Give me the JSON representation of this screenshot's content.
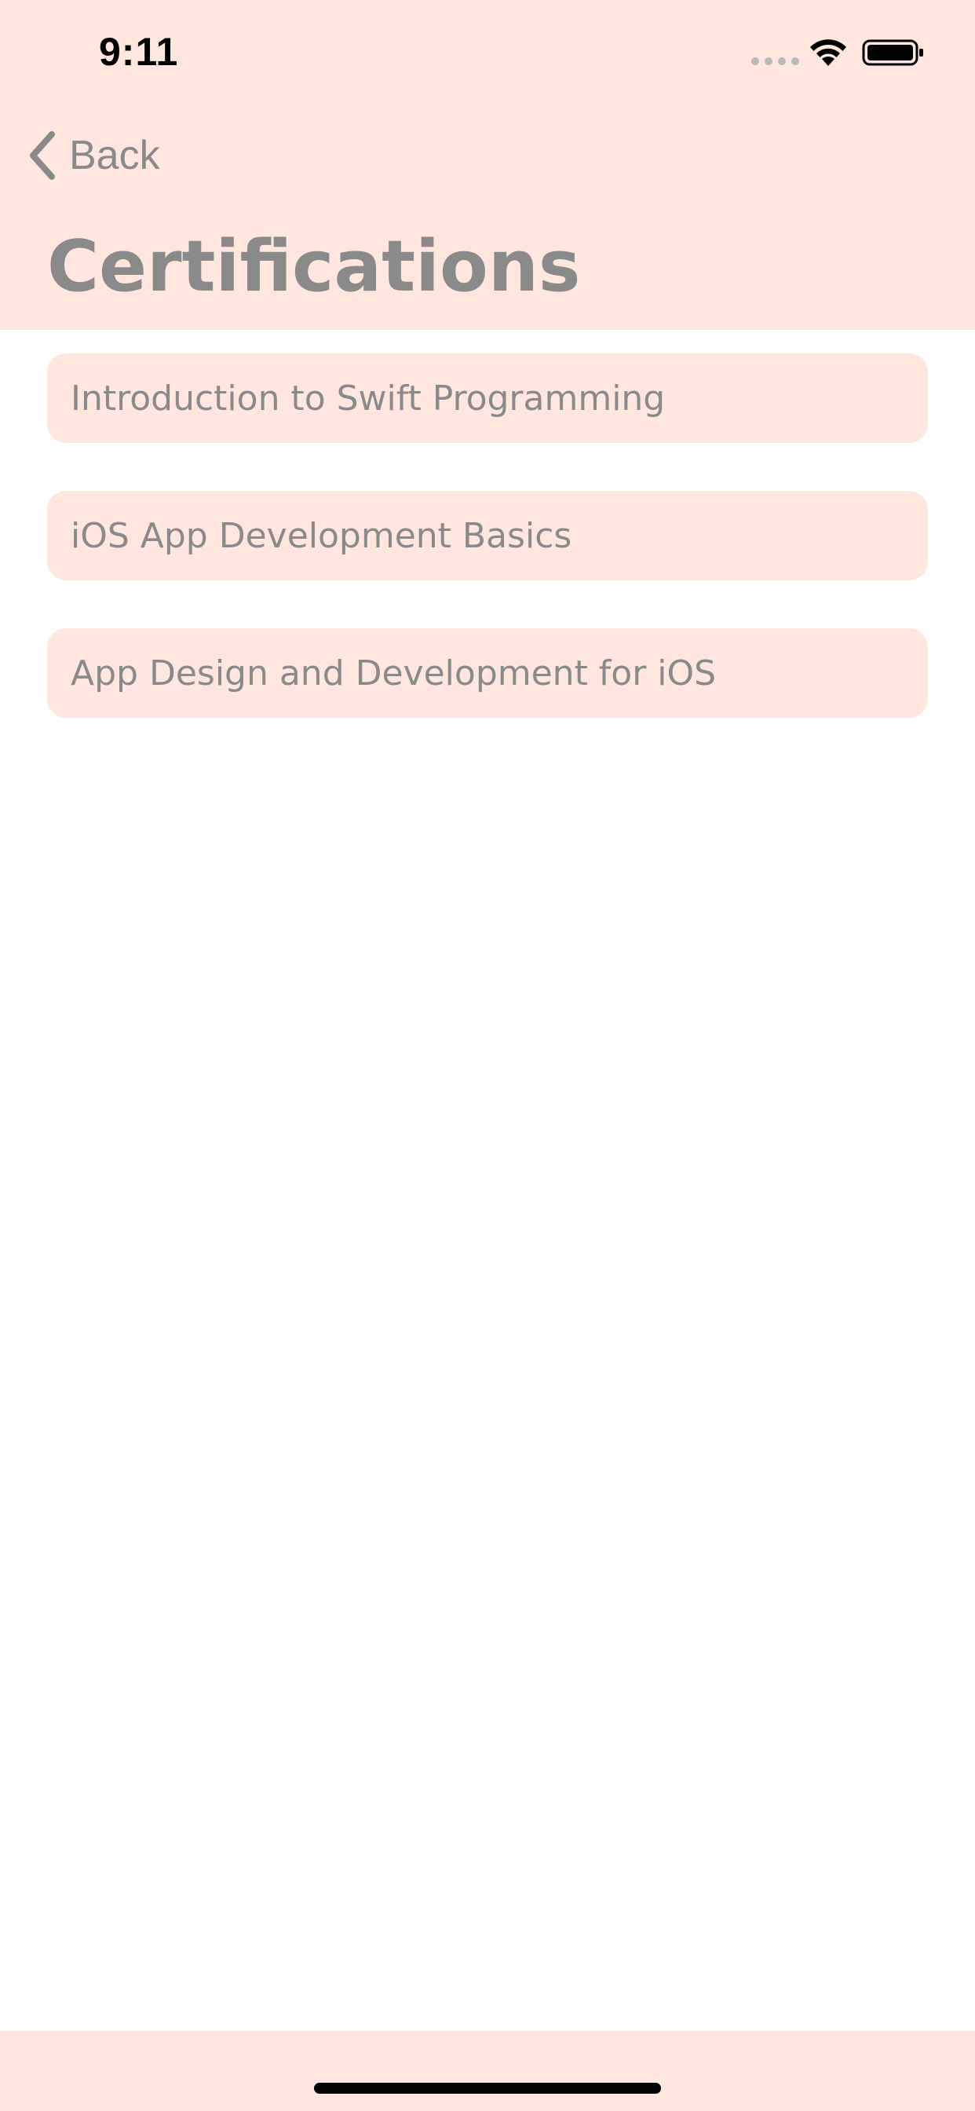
{
  "status_bar": {
    "time": "9:11"
  },
  "nav": {
    "back_label": "Back",
    "back_icon": "chevron-left-icon"
  },
  "page": {
    "title": "Certifications"
  },
  "certifications": [
    {
      "label": "Introduction to Swift Programming"
    },
    {
      "label": "iOS App Development Basics"
    },
    {
      "label": "App Design and Development for iOS"
    }
  ],
  "colors": {
    "header_background": "#ffe7df",
    "card_background": "#ffe7df",
    "text_gray": "#8a8a8a",
    "page_background": "#ffffff"
  }
}
